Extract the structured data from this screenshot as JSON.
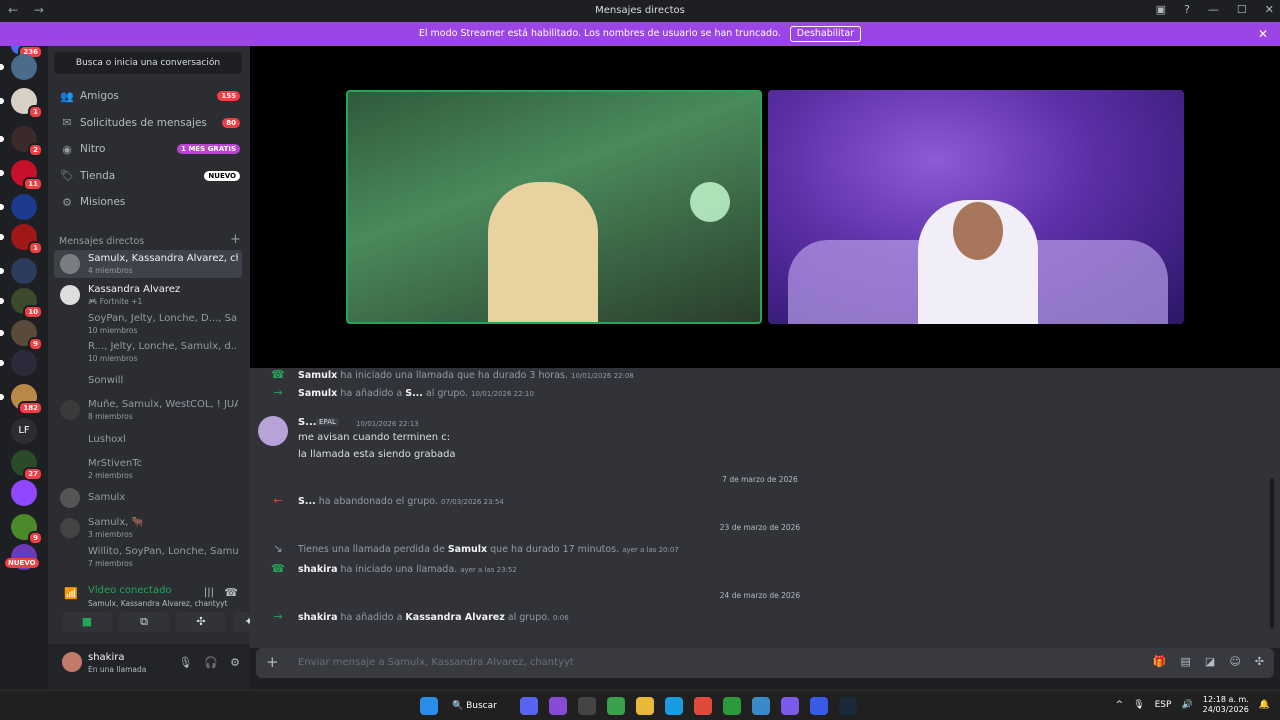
{
  "window": {
    "title": "Mensajes directos",
    "nav": "← →"
  },
  "banner": {
    "text": "El modo Streamer está habilitado. Los nombres de usuario se han truncado.",
    "button": "Deshabilitar"
  },
  "guilds": [
    {
      "badge": "236",
      "color": "#5865f2"
    },
    {
      "badge": "",
      "color": "#4a6b8a"
    },
    {
      "badge": "1",
      "color": "#d8d0c4"
    },
    {
      "badge": "2",
      "color": "#3a2a2a"
    },
    {
      "badge": "11",
      "color": "#c8102e"
    },
    {
      "badge": "",
      "color": "#1d3b8c"
    },
    {
      "badge": "1",
      "color": "#a01818"
    },
    {
      "badge": "",
      "color": "#2d3b5c"
    },
    {
      "badge": "10",
      "color": "#3a4a2a"
    },
    {
      "badge": "9",
      "color": "#5a4a3a"
    },
    {
      "badge": "",
      "color": "#2a2a3a"
    },
    {
      "badge": "182",
      "color": "#b88a4a"
    },
    {
      "badge": "",
      "color": "#2b2d31",
      "text": "LF"
    },
    {
      "badge": "27",
      "color": "#2a4a2a"
    },
    {
      "badge": "",
      "color": "#9146ff"
    },
    {
      "badge": "9",
      "color": "#4a8a2a"
    },
    {
      "badge": "",
      "color": "#6a3ab8"
    }
  ],
  "guild_new": "NUEVO",
  "search": {
    "placeholder": "Busca o inicia una conversación"
  },
  "nav": [
    {
      "label": "Amigos",
      "badge": "155",
      "icon": "friends-icon"
    },
    {
      "label": "Solicitudes de mensajes",
      "badge": "80",
      "icon": "mail-icon"
    },
    {
      "label": "Nitro",
      "badge": "1 MES GRATIS",
      "icon": "nitro-icon"
    },
    {
      "label": "Tienda",
      "badge": "NUEVO",
      "icon": "shop-icon"
    },
    {
      "label": "Misiones",
      "badge": "",
      "icon": "quests-icon"
    }
  ],
  "dm_header": "Mensajes directos",
  "dms": [
    {
      "name": "Samulx, Kassandra Alvarez, cha...",
      "sub": "4 miembros"
    },
    {
      "name": "Kassandra Alvarez",
      "sub": "🎮 Fortnite +1"
    },
    {
      "name": "SoyPan, Jelty, Lonche, D..., Sam...",
      "sub": "10 miembros"
    },
    {
      "name": "R..., Jelty, Lonche, Samulx, d..., ...",
      "sub": "10 miembros"
    },
    {
      "name": "Sonwill",
      "sub": ""
    },
    {
      "name": "Muñe, Samulx, WestCOL, ! JUA...",
      "sub": "8 miembros"
    },
    {
      "name": "Lushoxl",
      "sub": ""
    },
    {
      "name": "MrStivenTc",
      "sub": "2 miembros"
    },
    {
      "name": "Samulx",
      "sub": ""
    },
    {
      "name": "Samulx, 🐂",
      "sub": "3 miembros"
    },
    {
      "name": "Willito, SoyPan, Lonche, Samul...",
      "sub": "7 miembros"
    }
  ],
  "voice": {
    "status": "Vídeo conectado",
    "channel": "Samulx, Kassandra Alvarez, chantyyt"
  },
  "user": {
    "name": "shakira",
    "status": "En una llamada"
  },
  "chat": {
    "e1": {
      "name": "Samulx",
      "text": " ha iniciado una llamada que ha durado 3 horas. ",
      "ts": "10/01/2026 22:08"
    },
    "e2": {
      "name": "Samulx",
      "text": " ha añadido a ",
      "target": "S...",
      "text2": " al grupo. ",
      "ts": "10/01/2026 22:10"
    },
    "msg": {
      "name": "S...",
      "tag": "EPAL",
      "ts": "10/01/2026 22:13",
      "line1": "me avisan cuando terminen c:",
      "line2": "la llamada esta siendo grabada"
    },
    "sep1": "7 de marzo de 2026",
    "e3": {
      "name": "S...",
      "text": " ha abandonado el grupo. ",
      "ts": "07/03/2026 23:54"
    },
    "sep2": "23 de marzo de 2026",
    "e4": {
      "pre": "Tienes una llamada perdida de ",
      "name": "Samulx",
      "text": " que ha durado 17 minutos. ",
      "ts": "ayer a las 20:07"
    },
    "e5": {
      "name": "shakira",
      "text": " ha iniciado una llamada. ",
      "ts": "ayer a las 23:52"
    },
    "sep3": "24 de marzo de 2026",
    "e6": {
      "name": "shakira",
      "text": " ha añadido a ",
      "target": "Kassandra Alvarez",
      "text2": " al grupo. ",
      "ts": "0:06"
    }
  },
  "composer": {
    "placeholder": "Enviar mensaje a Samulx, Kassandra Alvarez, chantyyt"
  },
  "taskbar": {
    "search": "Buscar",
    "lang": "ESP",
    "time": "12:18 a. m.",
    "date": "24/03/2026"
  },
  "colors": {
    "accent": "#9b45e4",
    "green": "#23a55a",
    "red": "#f23f43"
  }
}
